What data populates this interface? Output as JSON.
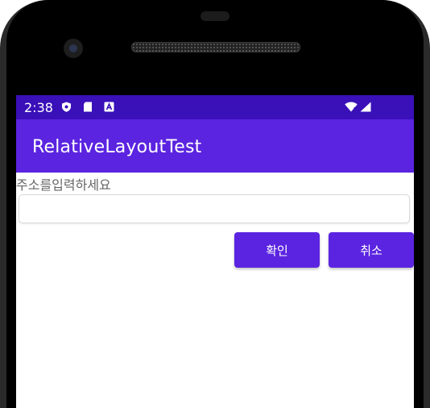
{
  "status_bar": {
    "time": "2:38",
    "icons": [
      "shield-icon",
      "sd-card-icon",
      "app-a-icon",
      "wifi-icon",
      "signal-icon"
    ]
  },
  "app_bar": {
    "title": "RelativeLayoutTest"
  },
  "form": {
    "label": "주소를입력하세요",
    "address_value": "",
    "address_placeholder": "",
    "ok_label": "확인",
    "cancel_label": "취소"
  },
  "colors": {
    "status_bar": "#3a10b8",
    "primary": "#5b24e0",
    "label_text": "#666666"
  }
}
